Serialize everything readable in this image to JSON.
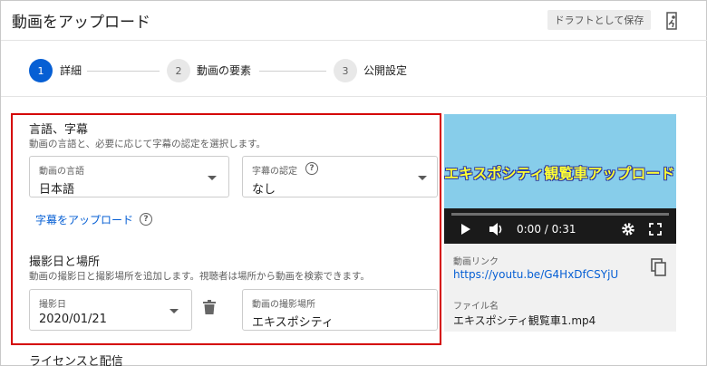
{
  "header": {
    "title": "動画をアップロード",
    "draft_button": "ドラフトとして保存",
    "exit_icon": "exit-icon"
  },
  "stepper": {
    "steps": [
      {
        "number": "1",
        "label": "詳細",
        "active": true
      },
      {
        "number": "2",
        "label": "動画の要素",
        "active": false
      },
      {
        "number": "3",
        "label": "公開設定",
        "active": false
      }
    ]
  },
  "language_section": {
    "title": "言語、字幕",
    "description": "動画の言語と、必要に応じて字幕の認定を選択します。",
    "video_language": {
      "label": "動画の言語",
      "value": "日本語"
    },
    "caption_certification": {
      "label": "字幕の認定",
      "value": "なし"
    },
    "upload_captions_link": "字幕をアップロード"
  },
  "recording_section": {
    "title": "撮影日と場所",
    "description": "動画の撮影日と撮影場所を追加します。視聴者は場所から動画を検索できます。",
    "recording_date": {
      "label": "撮影日",
      "value": "2020/01/21"
    },
    "video_location": {
      "label": "動画の撮影場所",
      "value": "エキスポシティ"
    }
  },
  "license_section": {
    "title": "ライセンスと配信"
  },
  "video_preview": {
    "caption": "エキスポシティ観覧車アップロード！",
    "time": "0:00 / 0:31"
  },
  "video_info": {
    "link_label": "動画リンク",
    "link": "https://youtu.be/G4HxDfCSYjU",
    "filename_label": "ファイル名",
    "filename": "エキスポシティ観覧車1.mp4"
  },
  "colors": {
    "accent": "#065fd4",
    "highlight_border": "#d40000",
    "video_background": "#87cdea",
    "video_caption": "#ffff33"
  }
}
